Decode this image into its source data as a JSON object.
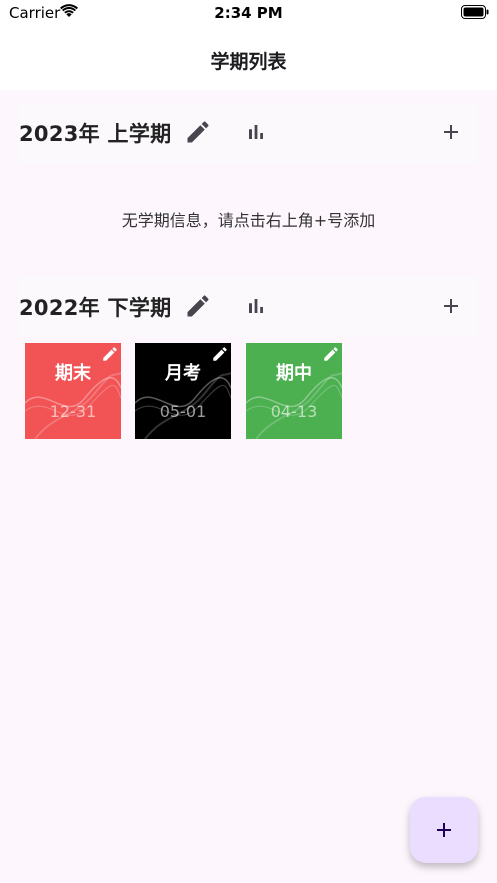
{
  "status_bar": {
    "carrier": "Carrier",
    "time": "2:34 PM"
  },
  "app_bar": {
    "title": "学期列表"
  },
  "semesters": [
    {
      "title": "2023年 上学期",
      "empty_message": "无学期信息，请点击右上角+号添加"
    },
    {
      "title": "2022年 下学期",
      "exams": [
        {
          "name": "期末",
          "date": "12-31",
          "color": "#f25456"
        },
        {
          "name": "月考",
          "date": "05-01",
          "color": "#000000"
        },
        {
          "name": "期中",
          "date": "04-13",
          "color": "#4caf50"
        }
      ]
    }
  ],
  "colors": {
    "background": "#fdf7fd",
    "fab": "#eaddff",
    "icon": "#49454f"
  },
  "icons": {
    "edit": "pencil-icon",
    "stats": "bar-chart-icon",
    "add": "plus-icon"
  }
}
